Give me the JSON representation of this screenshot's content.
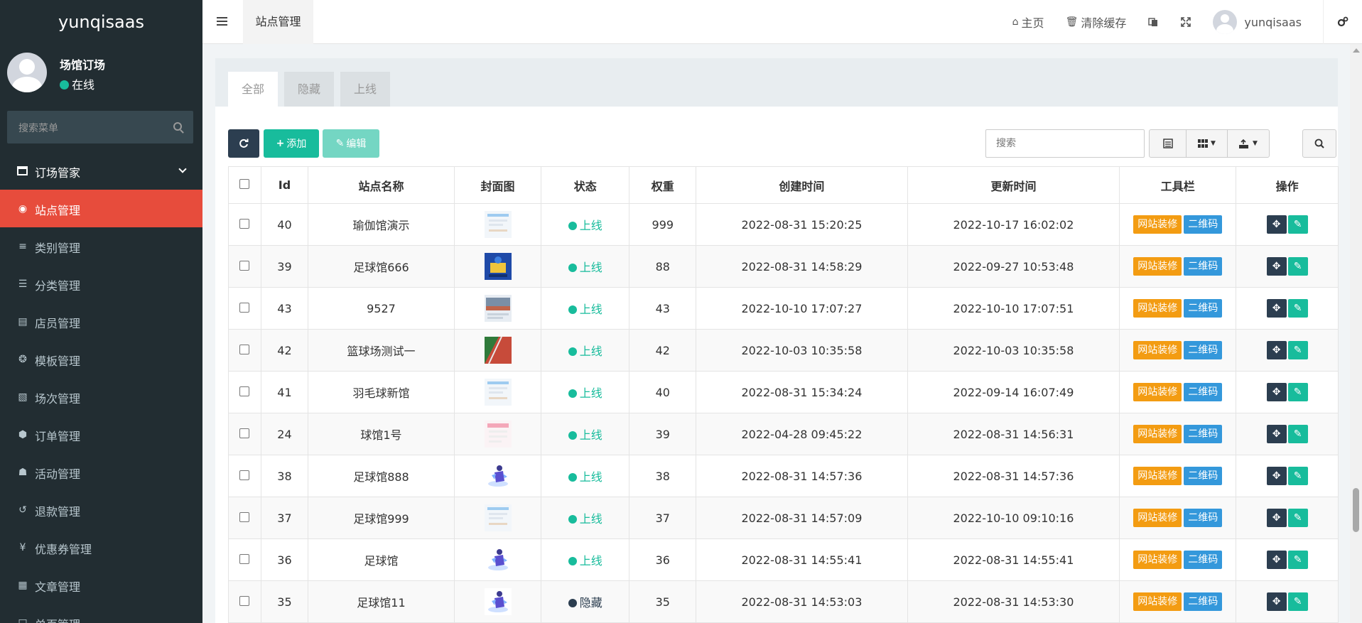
{
  "app": {
    "brand": "yunqisaas"
  },
  "user_panel": {
    "name": "场馆订场",
    "status": "在线"
  },
  "sidebar_search": {
    "placeholder": "搜索菜单"
  },
  "menu_header": {
    "label": "订场管家"
  },
  "menu": [
    {
      "label": "站点管理",
      "icon": "globe-icon",
      "active": true
    },
    {
      "label": "类别管理",
      "icon": "list-icon"
    },
    {
      "label": "分类管理",
      "icon": "bars-icon"
    },
    {
      "label": "店员管理",
      "icon": "id-card-icon"
    },
    {
      "label": "模板管理",
      "icon": "palette-icon"
    },
    {
      "label": "场次管理",
      "icon": "puzzle-icon"
    },
    {
      "label": "订单管理",
      "icon": "cube-icon"
    },
    {
      "label": "活动管理",
      "icon": "gift-icon"
    },
    {
      "label": "退款管理",
      "icon": "undo-icon"
    },
    {
      "label": "优惠券管理",
      "icon": "yen-icon"
    },
    {
      "label": "文章管理",
      "icon": "newspaper-icon"
    },
    {
      "label": "单页管理",
      "icon": "file-icon"
    }
  ],
  "topbar": {
    "tab": "站点管理",
    "home": "主页",
    "clear_cache": "清除缓存",
    "username": "yunqisaas"
  },
  "tabs": [
    "全部",
    "隐藏",
    "上线"
  ],
  "toolbar": {
    "add": "添加",
    "edit": "编辑",
    "search_placeholder": "搜索"
  },
  "table": {
    "headers": [
      "Id",
      "站点名称",
      "封面图",
      "状态",
      "权重",
      "创建时间",
      "更新时间",
      "工具栏",
      "操作"
    ],
    "tool_labels": {
      "decorate": "网站装修",
      "qrcode": "二维码"
    },
    "rows": [
      {
        "id": "40",
        "name": "瑜伽馆演示",
        "cover": "light",
        "status": "上线",
        "online": true,
        "weight": "999",
        "created": "2022-08-31 15:20:25",
        "updated": "2022-10-17 16:02:02"
      },
      {
        "id": "39",
        "name": "足球馆666",
        "cover": "blue",
        "status": "上线",
        "online": true,
        "weight": "88",
        "created": "2022-08-31 14:58:29",
        "updated": "2022-09-27 10:53:48"
      },
      {
        "id": "43",
        "name": "9527",
        "cover": "photo",
        "status": "上线",
        "online": true,
        "weight": "43",
        "created": "2022-10-10 17:07:27",
        "updated": "2022-10-10 17:07:51"
      },
      {
        "id": "42",
        "name": "篮球场测试一",
        "cover": "green",
        "status": "上线",
        "online": true,
        "weight": "42",
        "created": "2022-10-03 10:35:58",
        "updated": "2022-10-03 10:35:58"
      },
      {
        "id": "41",
        "name": "羽毛球新馆",
        "cover": "light",
        "status": "上线",
        "online": true,
        "weight": "40",
        "created": "2022-08-31 15:34:24",
        "updated": "2022-09-14 16:07:49"
      },
      {
        "id": "24",
        "name": "球馆1号",
        "cover": "pink",
        "status": "上线",
        "online": true,
        "weight": "39",
        "created": "2022-04-28 09:45:22",
        "updated": "2022-08-31 14:56:31"
      },
      {
        "id": "38",
        "name": "足球馆888",
        "cover": "figure",
        "status": "上线",
        "online": true,
        "weight": "38",
        "created": "2022-08-31 14:57:36",
        "updated": "2022-08-31 14:57:36"
      },
      {
        "id": "37",
        "name": "足球馆999",
        "cover": "light",
        "status": "上线",
        "online": true,
        "weight": "37",
        "created": "2022-08-31 14:57:09",
        "updated": "2022-10-10 09:10:16"
      },
      {
        "id": "36",
        "name": "足球馆",
        "cover": "figure",
        "status": "上线",
        "online": true,
        "weight": "36",
        "created": "2022-08-31 14:55:41",
        "updated": "2022-08-31 14:55:41"
      },
      {
        "id": "35",
        "name": "足球馆11",
        "cover": "figure",
        "status": "隐藏",
        "online": false,
        "weight": "35",
        "created": "2022-08-31 14:53:03",
        "updated": "2022-08-31 14:53:30"
      }
    ]
  },
  "colors": {
    "sidebar_bg": "#222d32",
    "active_menu": "#e74c3c",
    "online": "#18bc9c",
    "hidden": "#2c3e50",
    "decorate_tag": "#f39c12",
    "qrcode_tag": "#3498db"
  }
}
